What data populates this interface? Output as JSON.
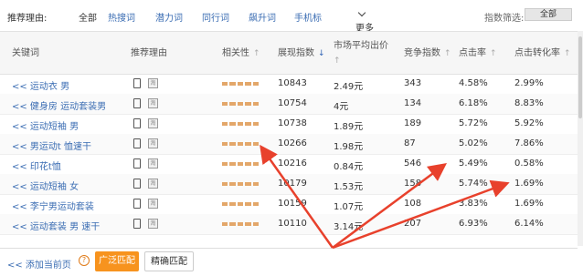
{
  "filters": {
    "label": "推荐理由:",
    "items": [
      "全部",
      "热搜词",
      "潜力词",
      "同行词",
      "飙升词",
      "手机标"
    ],
    "more": "更多",
    "index_filter_label": "指数筛选:",
    "index_filter_value": "全部"
  },
  "table": {
    "headers": [
      "关键词",
      "推荐理由",
      "相关性",
      "展现指数",
      "市场平均出价",
      "竞争指数",
      "点击率",
      "点击转化率"
    ],
    "rows": [
      {
        "keyword": "<< 运动衣 男",
        "relevance": 5,
        "impressions": "10843",
        "avg_bid": "2.49元",
        "competition": "343",
        "ctr": "4.58%",
        "cvr": "2.99%"
      },
      {
        "keyword": "<< 健身房 运动套装男",
        "relevance": 5,
        "impressions": "10754",
        "avg_bid": "4元",
        "competition": "134",
        "ctr": "6.18%",
        "cvr": "8.83%"
      },
      {
        "keyword": "<< 运动短袖 男",
        "relevance": 5,
        "impressions": "10738",
        "avg_bid": "1.89元",
        "competition": "189",
        "ctr": "5.72%",
        "cvr": "5.92%"
      },
      {
        "keyword": "<< 男运动t 恤速干",
        "relevance": 5,
        "impressions": "10266",
        "avg_bid": "1.98元",
        "competition": "87",
        "ctr": "5.02%",
        "cvr": "7.86%"
      },
      {
        "keyword": "<< 印花t恤",
        "relevance": 5,
        "impressions": "10216",
        "avg_bid": "0.84元",
        "competition": "546",
        "ctr": "5.49%",
        "cvr": "0.58%"
      },
      {
        "keyword": "<< 运动短袖 女",
        "relevance": 5,
        "impressions": "10179",
        "avg_bid": "1.53元",
        "competition": "158",
        "ctr": "5.74%",
        "cvr": "1.69%"
      },
      {
        "keyword": "<< 李宁男运动套装",
        "relevance": 5,
        "impressions": "10159",
        "avg_bid": "1.07元",
        "competition": "108",
        "ctr": "3.83%",
        "cvr": "1.69%"
      },
      {
        "keyword": "<< 运动套装 男 速干",
        "relevance": 5,
        "impressions": "10110",
        "avg_bid": "3.14元",
        "competition": "207",
        "ctr": "6.93%",
        "cvr": "6.14%"
      }
    ]
  },
  "footer": {
    "add_label": "<< 添加当前页",
    "help_icon": "?",
    "broad_match": "广泛匹配",
    "exact_match": "精确匹配"
  },
  "colors": {
    "link": "#3b6db3",
    "bar": "#e3a76a",
    "accent": "#f7931e",
    "annotation": "#e8412c"
  }
}
